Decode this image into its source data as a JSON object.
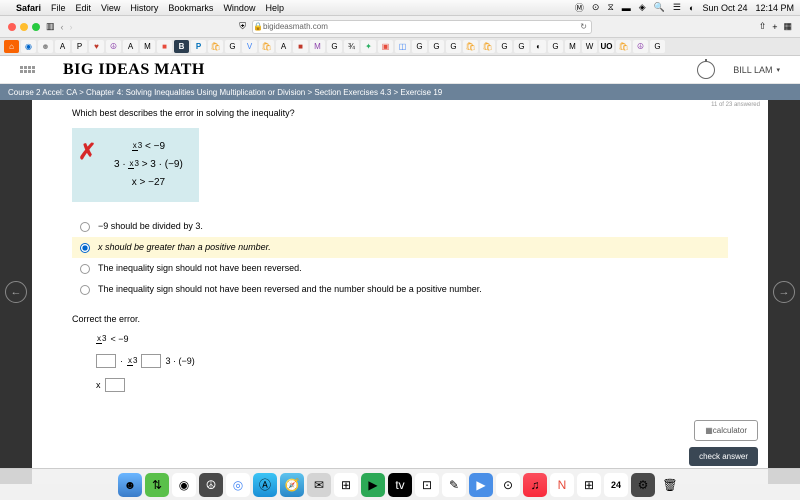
{
  "menubar": {
    "app": "Safari",
    "items": [
      "File",
      "Edit",
      "View",
      "History",
      "Bookmarks",
      "Window",
      "Help"
    ],
    "date": "Sun Oct 24",
    "time": "12:14 PM"
  },
  "browser": {
    "url": "bigideasmath.com"
  },
  "header": {
    "logo": "BIG IDEAS MATH",
    "user": "BILL LAM"
  },
  "breadcrumb": "Course 2 Accel: CA > Chapter 4: Solving Inequalities Using Multiplication or Division > Section Exercises 4.3 > Exercise 19",
  "question": {
    "number": "19",
    "prompt": "Which best describes the error in solving the inequality?",
    "work_l1_lhs_num": "x",
    "work_l1_lhs_den": "3",
    "work_l1_rest": "< −9",
    "work_l2_pre": "3 · ",
    "work_l2_num": "x",
    "work_l2_den": "3",
    "work_l2_rest": " > 3 · (−9)",
    "work_l3": "x > −27",
    "options": [
      "−9 should be divided by 3.",
      "x should be greater than a positive number.",
      "The inequality sign should not have been reversed.",
      "The inequality sign should not have been reversed and the number should be a positive number."
    ],
    "correct_label": "Correct the error.",
    "m1_num": "x",
    "m1_den": "3",
    "m1_rest": " < −9",
    "m2_pre": "· ",
    "m2_num": "x",
    "m2_den": "3",
    "m2_post": "3 · (−9)",
    "m3_pre": "x"
  },
  "buttons": {
    "calc": "calculator",
    "check": "check answer"
  },
  "progress": "11 of 23 answered"
}
